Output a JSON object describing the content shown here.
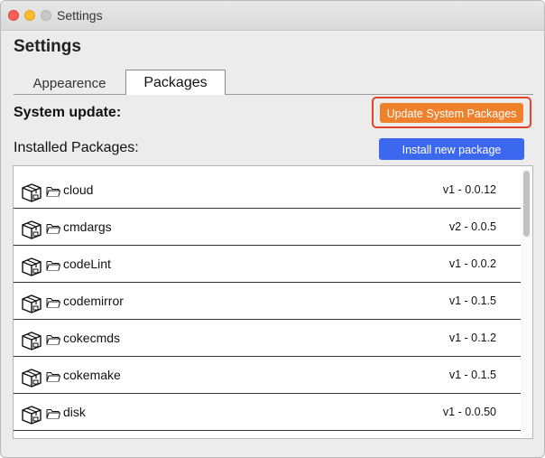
{
  "window": {
    "title": "Settings"
  },
  "page": {
    "title": "Settings"
  },
  "tabs": [
    {
      "label": "Appearence",
      "active": false
    },
    {
      "label": "Packages",
      "active": true
    }
  ],
  "system_update": {
    "label": "System update:",
    "button_label": "Update System Packages",
    "button_color": "#f0812c",
    "highlight_color": "#e2452a"
  },
  "installed": {
    "label": "Installed Packages:",
    "button_label": "Install new package",
    "button_color": "#3c68f0"
  },
  "packages": [
    {
      "name": "cloud",
      "version": "v1 - 0.0.12"
    },
    {
      "name": "cmdargs",
      "version": "v2 - 0.0.5"
    },
    {
      "name": "codeLint",
      "version": "v1 - 0.0.2"
    },
    {
      "name": "codemirror",
      "version": "v1 - 0.1.5"
    },
    {
      "name": "cokecmds",
      "version": "v1 - 0.1.2"
    },
    {
      "name": "cokemake",
      "version": "v1 - 0.1.5"
    },
    {
      "name": "disk",
      "version": "v1 - 0.0.50"
    }
  ]
}
